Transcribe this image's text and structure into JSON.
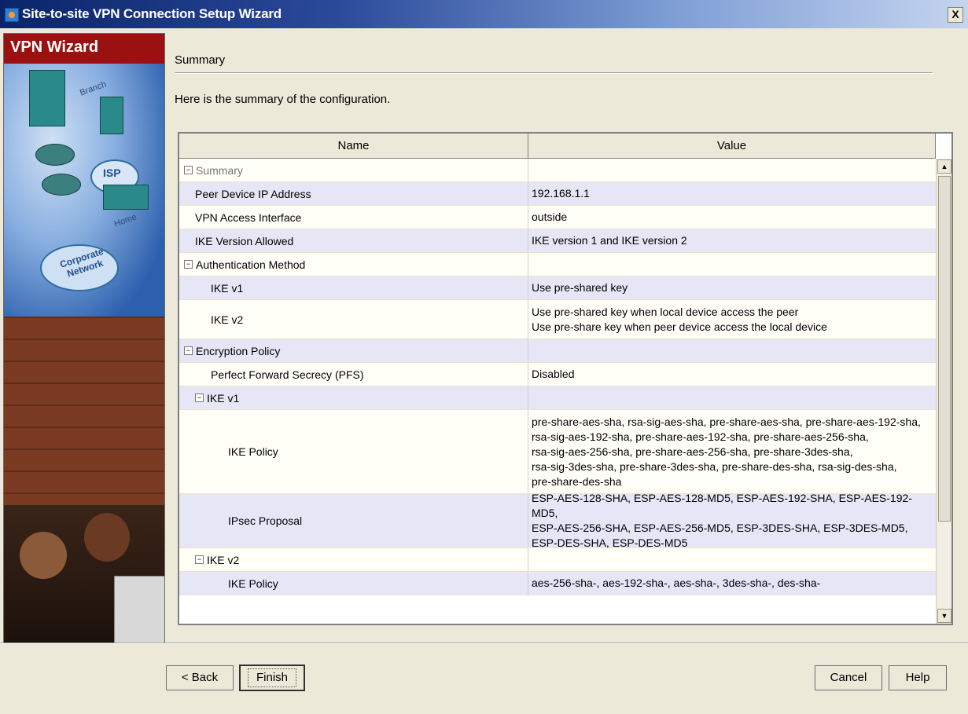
{
  "window": {
    "title": "Site-to-site VPN Connection Setup Wizard",
    "close_glyph": "X"
  },
  "sidepanel": {
    "title": "VPN Wizard",
    "image_labels": {
      "branch": "Branch",
      "isp": "ISP",
      "home": "Home",
      "corporate": "Corporate Network"
    }
  },
  "page": {
    "section_title": "Summary",
    "intro": "Here is the summary of the configuration."
  },
  "table": {
    "columns": [
      "Name",
      "Value"
    ],
    "rows": [
      {
        "name": "Summary",
        "value": [],
        "kind": "group-muted",
        "indent": 0,
        "toggle": "−"
      },
      {
        "name": "Peer Device IP Address",
        "value": [
          "192.168.1.1"
        ],
        "kind": "alt",
        "indent": 1
      },
      {
        "name": "VPN Access Interface",
        "value": [
          "outside"
        ],
        "kind": "norm",
        "indent": 1
      },
      {
        "name": "IKE Version Allowed",
        "value": [
          "IKE version 1 and IKE version 2"
        ],
        "kind": "alt",
        "indent": 1
      },
      {
        "name": "Authentication Method",
        "value": [],
        "kind": "norm",
        "indent": 0,
        "toggle": "−"
      },
      {
        "name": "IKE v1",
        "value": [
          "Use pre-shared key"
        ],
        "kind": "alt",
        "indent": 2
      },
      {
        "name": "IKE v2",
        "value": [
          "Use pre-shared key when local device access the peer",
          "Use pre-share key when peer device access the local device"
        ],
        "kind": "norm",
        "indent": 2
      },
      {
        "name": "Encryption Policy",
        "value": [],
        "kind": "alt",
        "indent": 0,
        "toggle": "−"
      },
      {
        "name": "Perfect Forward Secrecy (PFS)",
        "value": [
          "Disabled"
        ],
        "kind": "norm",
        "indent": 2
      },
      {
        "name": "IKE v1",
        "value": [],
        "kind": "alt",
        "indent": 1,
        "toggle": "−"
      },
      {
        "name": "IKE Policy",
        "value": [
          "pre-share-aes-sha, rsa-sig-aes-sha, pre-share-aes-sha, pre-share-aes-192-sha,",
          "rsa-sig-aes-192-sha, pre-share-aes-192-sha, pre-share-aes-256-sha,",
          "rsa-sig-aes-256-sha, pre-share-aes-256-sha, pre-share-3des-sha,",
          "rsa-sig-3des-sha, pre-share-3des-sha, pre-share-des-sha, rsa-sig-des-sha,",
          "pre-share-des-sha"
        ],
        "kind": "norm",
        "indent": 3
      },
      {
        "name": "IPsec Proposal",
        "value": [
          "ESP-AES-128-SHA, ESP-AES-128-MD5, ESP-AES-192-SHA, ESP-AES-192-MD5,",
          "ESP-AES-256-SHA, ESP-AES-256-MD5, ESP-3DES-SHA, ESP-3DES-MD5,",
          "ESP-DES-SHA, ESP-DES-MD5"
        ],
        "kind": "alt",
        "indent": 3
      },
      {
        "name": "IKE v2",
        "value": [],
        "kind": "norm",
        "indent": 1,
        "toggle": "−"
      },
      {
        "name": "IKE Policy",
        "value": [
          "aes-256-sha-, aes-192-sha-, aes-sha-, 3des-sha-, des-sha-"
        ],
        "kind": "alt",
        "indent": 3
      }
    ]
  },
  "buttons": {
    "back": "< Back",
    "finish": "Finish",
    "cancel": "Cancel",
    "help": "Help"
  },
  "scrollbar": {
    "up_glyph": "▲",
    "down_glyph": "▼"
  }
}
